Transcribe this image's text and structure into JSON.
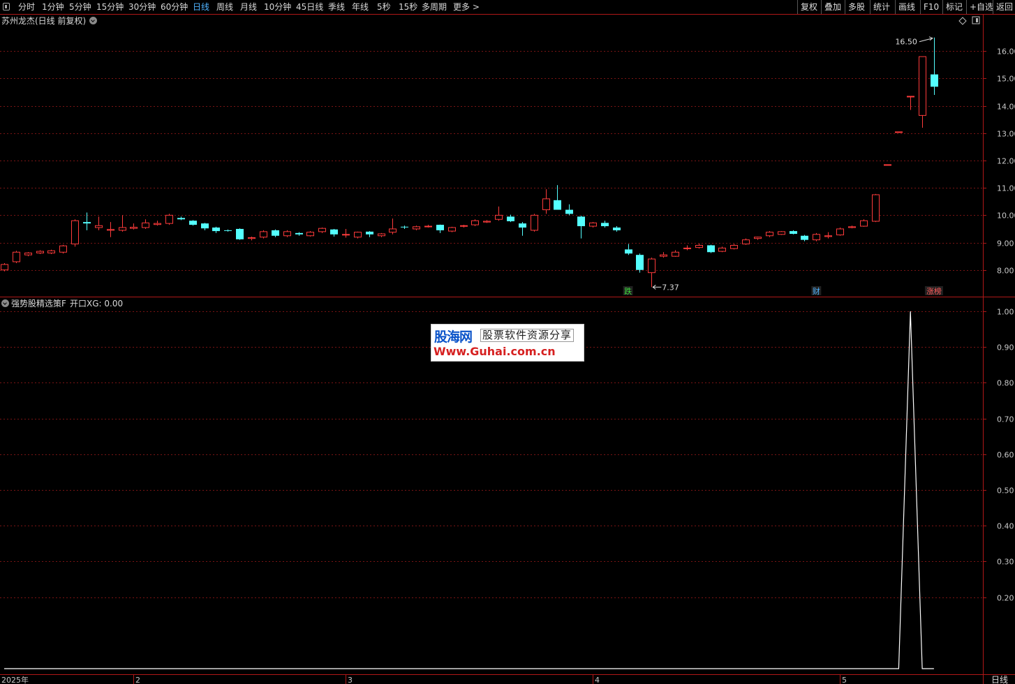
{
  "toolbar": {
    "periods": [
      {
        "label": "分时",
        "active": false
      },
      {
        "label": "1分钟",
        "active": false
      },
      {
        "label": "5分钟",
        "active": false
      },
      {
        "label": "15分钟",
        "active": false
      },
      {
        "label": "30分钟",
        "active": false
      },
      {
        "label": "60分钟",
        "active": false
      },
      {
        "label": "日线",
        "active": true
      },
      {
        "label": "周线",
        "active": false
      },
      {
        "label": "月线",
        "active": false
      },
      {
        "label": "10分钟",
        "active": false
      },
      {
        "label": "45日线",
        "active": false
      },
      {
        "label": "季线",
        "active": false
      },
      {
        "label": "年线",
        "active": false
      },
      {
        "label": "5秒",
        "active": false
      },
      {
        "label": "15秒",
        "active": false
      },
      {
        "label": "多周期",
        "active": false
      },
      {
        "label": "更多 >",
        "active": false
      }
    ],
    "right_buttons": [
      "复权",
      "叠加",
      "多股",
      "统计",
      "画线",
      "F10",
      "标记",
      "+自选",
      "返回"
    ]
  },
  "price_panel": {
    "title": "苏州龙杰(日线 前复权)",
    "yticks": [
      "16.00",
      "15.00",
      "14.00",
      "13.00",
      "12.00",
      "11.00",
      "10.00",
      "9.00",
      "8.00"
    ],
    "high_label": "16.50",
    "low_label": "7.37",
    "markers": [
      {
        "text": "跌",
        "index": 53,
        "color": "#3ddc3d"
      },
      {
        "text": "财",
        "index": 69,
        "color": "#4fb3ff"
      },
      {
        "text": "涨榜",
        "index": 79,
        "color": "#ff5a5a"
      }
    ]
  },
  "indicator_panel": {
    "title": "强势股精选策F",
    "value_label": "开口XG: 0.00",
    "yticks": [
      "1.00",
      "0.90",
      "0.80",
      "0.70",
      "0.60",
      "0.50",
      "0.40",
      "0.30",
      "0.20"
    ]
  },
  "x_axis": {
    "labels": [
      {
        "text": "2025年",
        "index": 0
      },
      {
        "text": "2",
        "index": 11
      },
      {
        "text": "3",
        "index": 29
      },
      {
        "text": "4",
        "index": 50
      },
      {
        "text": "5",
        "index": 71
      }
    ],
    "period_label": "日线"
  },
  "watermark": {
    "logo": "股海网",
    "slogan": "股票软件资源分享",
    "url": "Www.Guhai.com.cn"
  },
  "colors": {
    "up": "#ff3b3b",
    "down": "#54ffff",
    "grid": "#7a1414",
    "axis": "#b01818",
    "line": "#ffffff"
  },
  "chart_data": [
    {
      "type": "candlestick",
      "title": "苏州龙杰(日线 前复权)",
      "ylim": [
        7.1,
        16.85
      ],
      "series_ohlc": [
        [
          8.0,
          8.25,
          7.95,
          8.2
        ],
        [
          8.3,
          8.7,
          8.25,
          8.65
        ],
        [
          8.55,
          8.65,
          8.5,
          8.62
        ],
        [
          8.62,
          8.72,
          8.58,
          8.68
        ],
        [
          8.62,
          8.74,
          8.58,
          8.7
        ],
        [
          8.65,
          8.92,
          8.6,
          8.88
        ],
        [
          8.95,
          9.85,
          8.85,
          9.8
        ],
        [
          9.75,
          10.1,
          9.45,
          9.7
        ],
        [
          9.55,
          9.95,
          9.45,
          9.62
        ],
        [
          9.45,
          9.75,
          9.2,
          9.48
        ],
        [
          9.45,
          10.0,
          9.4,
          9.55
        ],
        [
          9.52,
          9.7,
          9.48,
          9.56
        ],
        [
          9.55,
          9.85,
          9.5,
          9.72
        ],
        [
          9.66,
          9.8,
          9.62,
          9.7
        ],
        [
          9.7,
          10.05,
          9.65,
          10.0
        ],
        [
          9.9,
          9.95,
          9.82,
          9.85
        ],
        [
          9.8,
          9.82,
          9.62,
          9.65
        ],
        [
          9.7,
          9.72,
          9.45,
          9.52
        ],
        [
          9.55,
          9.58,
          9.35,
          9.42
        ],
        [
          9.45,
          9.48,
          9.4,
          9.44
        ],
        [
          9.5,
          9.52,
          9.1,
          9.12
        ],
        [
          9.15,
          9.22,
          9.08,
          9.18
        ],
        [
          9.2,
          9.45,
          9.15,
          9.4
        ],
        [
          9.45,
          9.48,
          9.2,
          9.25
        ],
        [
          9.25,
          9.45,
          9.2,
          9.4
        ],
        [
          9.35,
          9.38,
          9.25,
          9.3
        ],
        [
          9.25,
          9.42,
          9.22,
          9.38
        ],
        [
          9.4,
          9.55,
          9.35,
          9.52
        ],
        [
          9.48,
          9.5,
          9.22,
          9.3
        ],
        [
          9.28,
          9.5,
          9.18,
          9.3
        ],
        [
          9.2,
          9.4,
          9.15,
          9.38
        ],
        [
          9.4,
          9.42,
          9.2,
          9.3
        ],
        [
          9.25,
          9.35,
          9.2,
          9.32
        ],
        [
          9.38,
          9.88,
          9.3,
          9.5
        ],
        [
          9.58,
          9.62,
          9.5,
          9.56
        ],
        [
          9.5,
          9.62,
          9.45,
          9.58
        ],
        [
          9.6,
          9.65,
          9.55,
          9.6
        ],
        [
          9.65,
          9.66,
          9.35,
          9.45
        ],
        [
          9.42,
          9.58,
          9.38,
          9.55
        ],
        [
          9.6,
          9.65,
          9.55,
          9.62
        ],
        [
          9.65,
          9.85,
          9.6,
          9.8
        ],
        [
          9.75,
          9.82,
          9.72,
          9.78
        ],
        [
          9.85,
          10.32,
          9.8,
          10.0
        ],
        [
          9.95,
          10.02,
          9.75,
          9.78
        ],
        [
          9.7,
          9.75,
          9.25,
          9.55
        ],
        [
          9.45,
          10.05,
          9.4,
          10.0
        ],
        [
          10.2,
          10.95,
          10.05,
          10.6
        ],
        [
          10.55,
          11.1,
          10.25,
          10.2
        ],
        [
          10.2,
          10.4,
          10.0,
          10.05
        ],
        [
          9.95,
          9.98,
          9.15,
          9.6
        ],
        [
          9.6,
          9.75,
          9.55,
          9.72
        ],
        [
          9.72,
          9.8,
          9.55,
          9.6
        ],
        [
          9.55,
          9.6,
          9.4,
          9.45
        ],
        [
          8.75,
          8.95,
          8.55,
          8.6
        ],
        [
          8.55,
          8.6,
          7.9,
          8.0
        ],
        [
          7.9,
          8.45,
          7.37,
          8.4
        ],
        [
          8.5,
          8.65,
          8.45,
          8.55
        ],
        [
          8.5,
          8.72,
          8.48,
          8.65
        ],
        [
          8.78,
          8.9,
          8.72,
          8.8
        ],
        [
          8.82,
          8.96,
          8.78,
          8.9
        ],
        [
          8.9,
          8.92,
          8.62,
          8.65
        ],
        [
          8.68,
          8.85,
          8.65,
          8.8
        ],
        [
          8.78,
          8.95,
          8.75,
          8.9
        ],
        [
          8.95,
          9.15,
          8.92,
          9.1
        ],
        [
          9.15,
          9.22,
          9.1,
          9.2
        ],
        [
          9.25,
          9.42,
          9.2,
          9.38
        ],
        [
          9.3,
          9.42,
          9.28,
          9.4
        ],
        [
          9.42,
          9.45,
          9.3,
          9.32
        ],
        [
          9.25,
          9.28,
          9.05,
          9.1
        ],
        [
          9.1,
          9.35,
          9.05,
          9.3
        ],
        [
          9.22,
          9.38,
          9.15,
          9.25
        ],
        [
          9.28,
          9.55,
          9.25,
          9.5
        ],
        [
          9.55,
          9.62,
          9.52,
          9.58
        ],
        [
          9.6,
          9.85,
          9.58,
          9.8
        ],
        [
          9.78,
          10.78,
          9.75,
          10.75
        ],
        [
          11.85,
          11.85,
          11.85,
          11.85
        ],
        [
          13.05,
          13.05,
          13.05,
          13.05
        ],
        [
          14.35,
          14.35,
          13.85,
          14.35
        ],
        [
          13.65,
          15.8,
          13.2,
          15.8
        ],
        [
          15.15,
          16.5,
          14.4,
          14.7
        ]
      ]
    },
    {
      "type": "line",
      "title": "强势股精选策F",
      "series": [
        {
          "name": "开口XG",
          "values": [
            0,
            0,
            0,
            0,
            0,
            0,
            0,
            0,
            0,
            0,
            0,
            0,
            0,
            0,
            0,
            0,
            0,
            0,
            0,
            0,
            0,
            0,
            0,
            0,
            0,
            0,
            0,
            0,
            0,
            0,
            0,
            0,
            0,
            0,
            0,
            0,
            0,
            0,
            0,
            0,
            0,
            0,
            0,
            0,
            0,
            0,
            0,
            0,
            0,
            0,
            0,
            0,
            0,
            0,
            0,
            0,
            0,
            0,
            0,
            0,
            0,
            0,
            0,
            0,
            0,
            0,
            0,
            0,
            0,
            0,
            0,
            0,
            0,
            0,
            0,
            0,
            0,
            1,
            0,
            0
          ]
        }
      ],
      "ylim": [
        0.0,
        1.0
      ]
    }
  ]
}
